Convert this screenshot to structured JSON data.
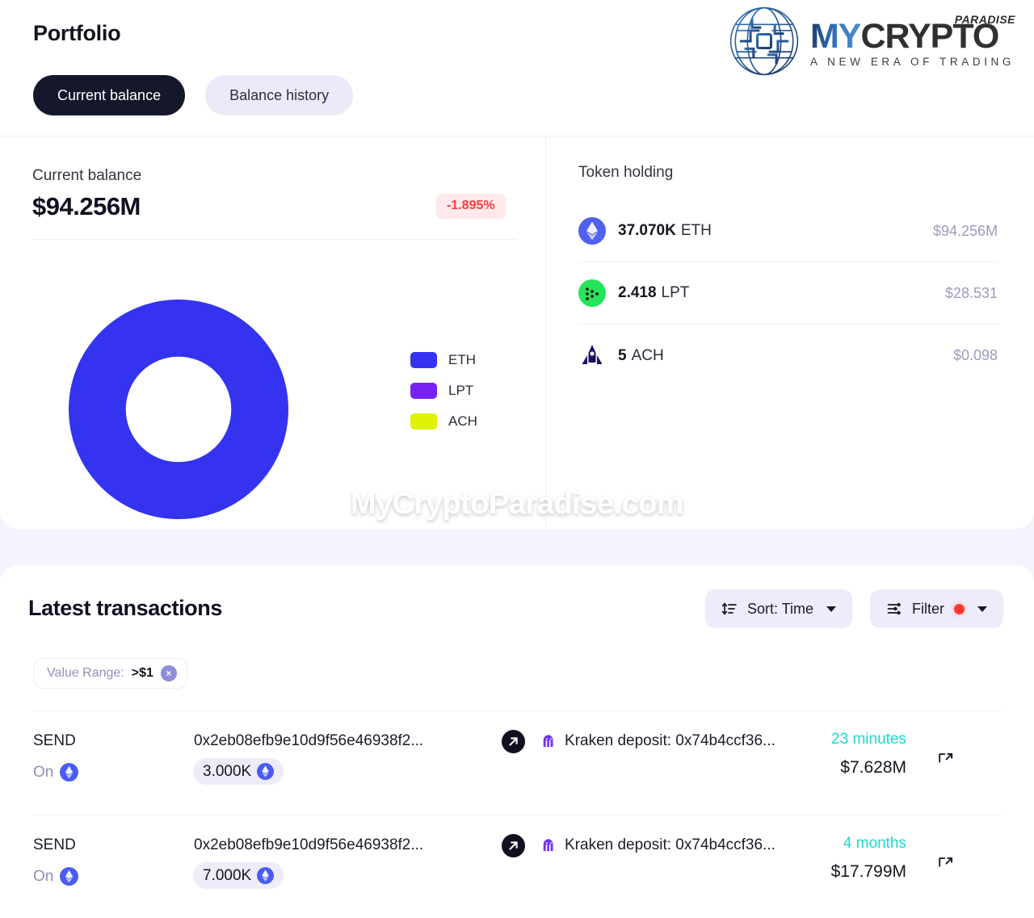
{
  "header": {
    "title": "Portfolio",
    "tabs": [
      {
        "label": "Current balance",
        "active": true
      },
      {
        "label": "Balance history",
        "active": false
      }
    ]
  },
  "logo": {
    "paradise": "PARADISE",
    "my": "MY",
    "crypto": "CRYPTO",
    "tagline": "A NEW ERA OF TRADING"
  },
  "balance": {
    "label": "Current balance",
    "value": "$94.256M",
    "change": "-1.895%",
    "change_color": "#ff3b41",
    "change_bg": "#ffe9ea"
  },
  "chart_data": {
    "type": "pie",
    "title": "Current balance",
    "labels": [
      "ETH",
      "LPT",
      "ACH"
    ],
    "values": [
      94256000,
      28.531,
      0.098
    ],
    "percents": [
      99.99997,
      3e-05,
      1e-07
    ],
    "colors": [
      "#3333f0",
      "#7622f5",
      "#dff105"
    ],
    "legend_position": "right",
    "grid": false,
    "donut_hole_ratio": 0.54
  },
  "token_holding": {
    "title": "Token holding",
    "rows": [
      {
        "amount": "37.070K",
        "symbol": "ETH",
        "usd": "$94.256M",
        "icon": "ethereum-icon"
      },
      {
        "amount": "2.418",
        "symbol": "LPT",
        "usd": "$28.531",
        "icon": "livepeer-icon"
      },
      {
        "amount": "5",
        "symbol": "ACH",
        "usd": "$0.098",
        "icon": "alchemypay-icon"
      }
    ]
  },
  "watermark": "MyCryptoParadise.com",
  "transactions": {
    "title": "Latest transactions",
    "sort": {
      "label": "Sort: Time",
      "icon": "sort-icon"
    },
    "filter": {
      "label": "Filter",
      "icon": "filter-sliders-icon",
      "dot_color": "#ff3b30"
    },
    "chip": {
      "label": "Value Range:",
      "value": ">$1",
      "close": "×"
    },
    "rows": [
      {
        "type": "SEND",
        "on_label": "On",
        "chain": "ethereum-icon",
        "hash": "0x2eb08efb9e10d9f56e46938f2...",
        "amount": "3.000K",
        "amount_icon": "ethereum-icon",
        "destination": "Kraken deposit: 0x74b4ccf36...",
        "destination_icon": "kraken-icon",
        "time": "23 minutes",
        "value": "$7.628M"
      },
      {
        "type": "SEND",
        "on_label": "On",
        "chain": "ethereum-icon",
        "hash": "0x2eb08efb9e10d9f56e46938f2...",
        "amount": "7.000K",
        "amount_icon": "ethereum-icon",
        "destination": "Kraken deposit: 0x74b4ccf36...",
        "destination_icon": "kraken-icon",
        "time": "4 months",
        "value": "$17.799M"
      }
    ]
  }
}
